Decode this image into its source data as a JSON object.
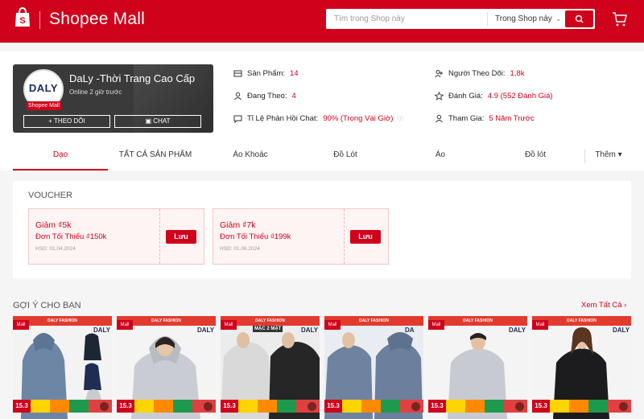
{
  "header": {
    "brand": "Shopee Mall",
    "search": {
      "placeholder": "Tìm trong Shop này",
      "scope": "Trong Shop này"
    }
  },
  "shop": {
    "avatar_text": "DALY",
    "mall_badge": "Shopee Mall",
    "name": "DaLy -Thời Trang Cao Cấp",
    "online": "Online 2 giờ trước",
    "follow_label": "+ THEO DÕI",
    "chat_label": "CHAT",
    "stats": {
      "products": {
        "label": "Sản Phẩm:",
        "value": "14"
      },
      "following": {
        "label": "Đang Theo:",
        "value": "4"
      },
      "chat_rate": {
        "label": "Tỉ Lệ Phản Hồi Chat:",
        "value": "90% (Trong Vài Giờ)"
      },
      "followers": {
        "label": "Người Theo Dõi:",
        "value": "1,8k"
      },
      "rating": {
        "label": "Đánh Giá:",
        "value": "4.9 (552 Đánh Giá)"
      },
      "joined": {
        "label": "Tham Gia:",
        "value": "5 Năm Trước"
      }
    }
  },
  "tabs": [
    {
      "label": "Dạo",
      "active": true
    },
    {
      "label": "TẤT CẢ SẢN PHẨM"
    },
    {
      "label": "Áo Khoác"
    },
    {
      "label": "Đồ Lót"
    },
    {
      "label": "Áo"
    },
    {
      "label": "Đồ lót"
    },
    {
      "label": "Thêm ▾"
    }
  ],
  "voucher": {
    "title": "VOUCHER",
    "items": [
      {
        "discount": "Giảm ₫5k",
        "min": "Đơn Tối Thiểu ₫150k",
        "expiry": "HSD: 01.04.2024",
        "button": "Lưu"
      },
      {
        "discount": "Giảm ₫7k",
        "min": "Đơn Tối Thiểu ₫199k",
        "expiry": "HSD: 01.06.2024",
        "button": "Lưu"
      }
    ]
  },
  "recommend": {
    "title": "GỢI Ý CHO BẠN",
    "see_all": "Xem Tất Cả",
    "products": [
      {
        "brand_strip": "DALY FASHION",
        "mall_tag": "Mall",
        "brand_logo": "DALY",
        "date_tag": "15.3",
        "extra": ""
      },
      {
        "brand_strip": "DALY FASHION",
        "mall_tag": "Mall",
        "brand_logo": "DALY",
        "date_tag": "15.3",
        "extra": ""
      },
      {
        "brand_strip": "DALY FASHION",
        "mall_tag": "Mall",
        "brand_logo": "DALY",
        "date_tag": "15.3",
        "extra": "MẶC 2 MẶT"
      },
      {
        "brand_strip": "DALY FASHION",
        "mall_tag": "Mall",
        "brand_logo": "DA",
        "date_tag": "15.3",
        "extra": ""
      },
      {
        "brand_strip": "DALY FASHION",
        "mall_tag": "Mall",
        "brand_logo": "DALY",
        "date_tag": "15.3",
        "extra": ""
      },
      {
        "brand_strip": "DALY FASHION",
        "mall_tag": "Mall",
        "brand_logo": "DALY",
        "date_tag": "15.3",
        "extra": ""
      }
    ]
  },
  "colors": {
    "accent": "#d0011b"
  }
}
